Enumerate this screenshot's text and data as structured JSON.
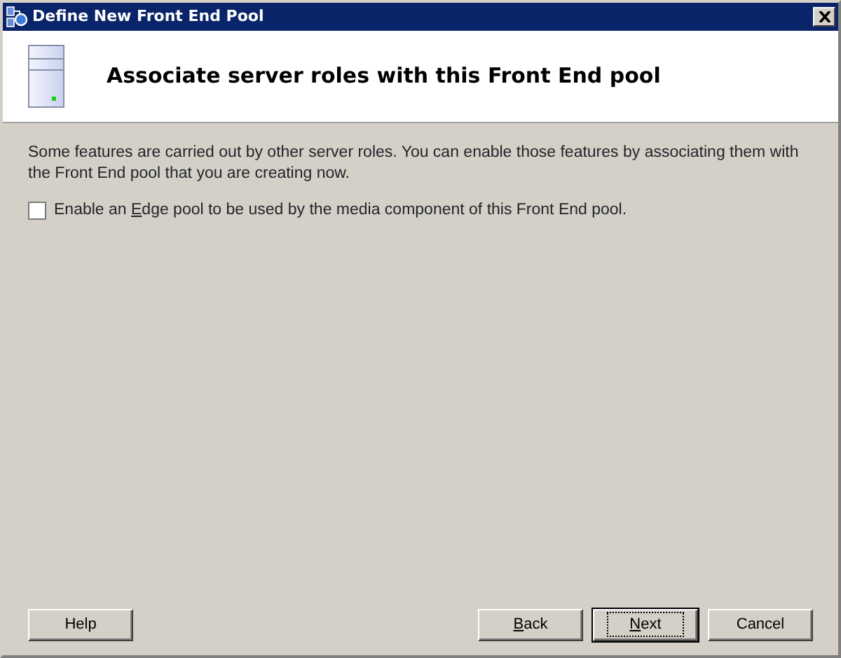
{
  "window": {
    "title": "Define New Front End Pool"
  },
  "header": {
    "title": "Associate server roles with this Front End pool"
  },
  "description": "Some features are carried out by other server roles. You can enable those features by associating them with the Front End pool that you are creating now.",
  "options": [
    {
      "text_before": "Enable an ",
      "access_key": "E",
      "text_after": "dge pool to be used by the media component of this Front End pool.",
      "checked": false
    }
  ],
  "buttons": [
    {
      "kind": "left",
      "text_before": "Help",
      "default": false
    },
    {
      "kind": "right",
      "access_key": "B",
      "text_after": "ack",
      "default": false
    },
    {
      "kind": "right",
      "access_key": "N",
      "text_after": "ext",
      "default": true
    },
    {
      "kind": "right",
      "text_before": "Cancel",
      "default": false
    }
  ]
}
